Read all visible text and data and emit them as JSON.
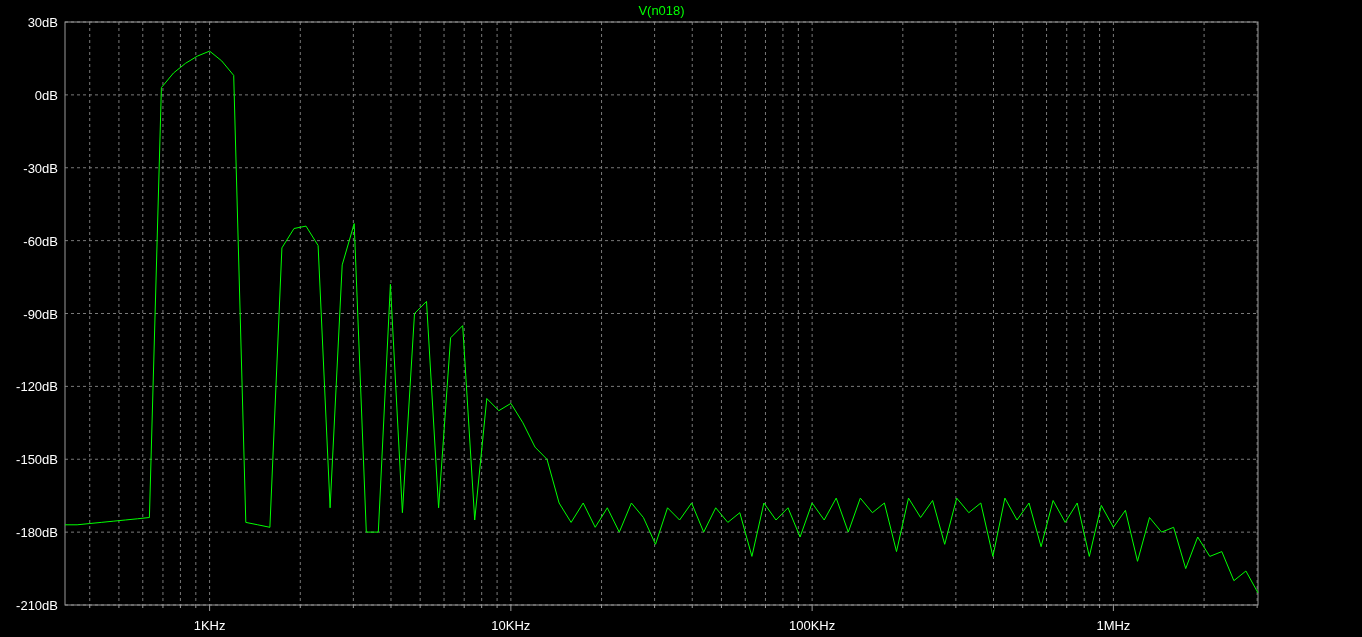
{
  "plot": {
    "chart_data": {
      "type": "line",
      "grid": true,
      "ylim": [
        -210,
        30
      ],
      "yticks": [
        {
          "value": 30,
          "label": "30dB"
        },
        {
          "value": 0,
          "label": "0dB"
        },
        {
          "value": -30,
          "label": "-30dB"
        },
        {
          "value": -60,
          "label": "-60dB"
        },
        {
          "value": -90,
          "label": "-90dB"
        },
        {
          "value": -120,
          "label": "-120dB"
        },
        {
          "value": -150,
          "label": "-150dB"
        },
        {
          "value": -180,
          "label": "-180dB"
        },
        {
          "value": -210,
          "label": "-210dB"
        }
      ],
      "categories": [
        null,
        null,
        null,
        null,
        null,
        null,
        null,
        null,
        null,
        null,
        null,
        null,
        "1KHz",
        null,
        null,
        null,
        null,
        null,
        null,
        null,
        null,
        null,
        null,
        null,
        null,
        null,
        null,
        null,
        null,
        null,
        null,
        null,
        null,
        null,
        null,
        null,
        null,
        "10KHz",
        null,
        null,
        null,
        null,
        null,
        null,
        null,
        null,
        null,
        null,
        null,
        null,
        null,
        null,
        null,
        null,
        null,
        null,
        null,
        null,
        null,
        null,
        null,
        null,
        "100KHz",
        null,
        null,
        null,
        null,
        null,
        null,
        null,
        null,
        null,
        null,
        null,
        null,
        null,
        null,
        null,
        null,
        null,
        null,
        null,
        null,
        null,
        null,
        null,
        null,
        "1MHz",
        null,
        null,
        null,
        null,
        null,
        null,
        null,
        null,
        null,
        null,
        null,
        null
      ],
      "series": [
        {
          "name": "V(n018)",
          "color": "#00ff00",
          "values": [
            -177,
            -177,
            -176.5,
            -176,
            -175.5,
            -175,
            -174.5,
            -174,
            3,
            9,
            13,
            16,
            18,
            14,
            8,
            -176,
            -177,
            -178,
            -63,
            -55,
            -54,
            -62,
            -170,
            -70,
            -53,
            -180,
            -180,
            -78,
            -172,
            -90,
            -85,
            -170,
            -100,
            -95,
            -175,
            -125,
            -130,
            -127,
            -135,
            -145,
            -150,
            -168,
            -176,
            -168,
            -178,
            -170,
            -180,
            -168,
            -174,
            -185,
            -170,
            -175,
            -168,
            -180,
            -170,
            -176,
            -172,
            -190,
            -168,
            -175,
            -170,
            -182,
            -168,
            -175,
            -166,
            -180,
            -166,
            -172,
            -168,
            -188,
            -166,
            -174,
            -167,
            -185,
            -166,
            -172,
            -168,
            -190,
            -166,
            -175,
            -168,
            -186,
            -167,
            -176,
            -168,
            -190,
            -169,
            -178,
            -171,
            -192,
            -174,
            -180,
            -178,
            -195,
            -182,
            -190,
            -188,
            -200,
            -196,
            -205
          ]
        }
      ]
    }
  }
}
